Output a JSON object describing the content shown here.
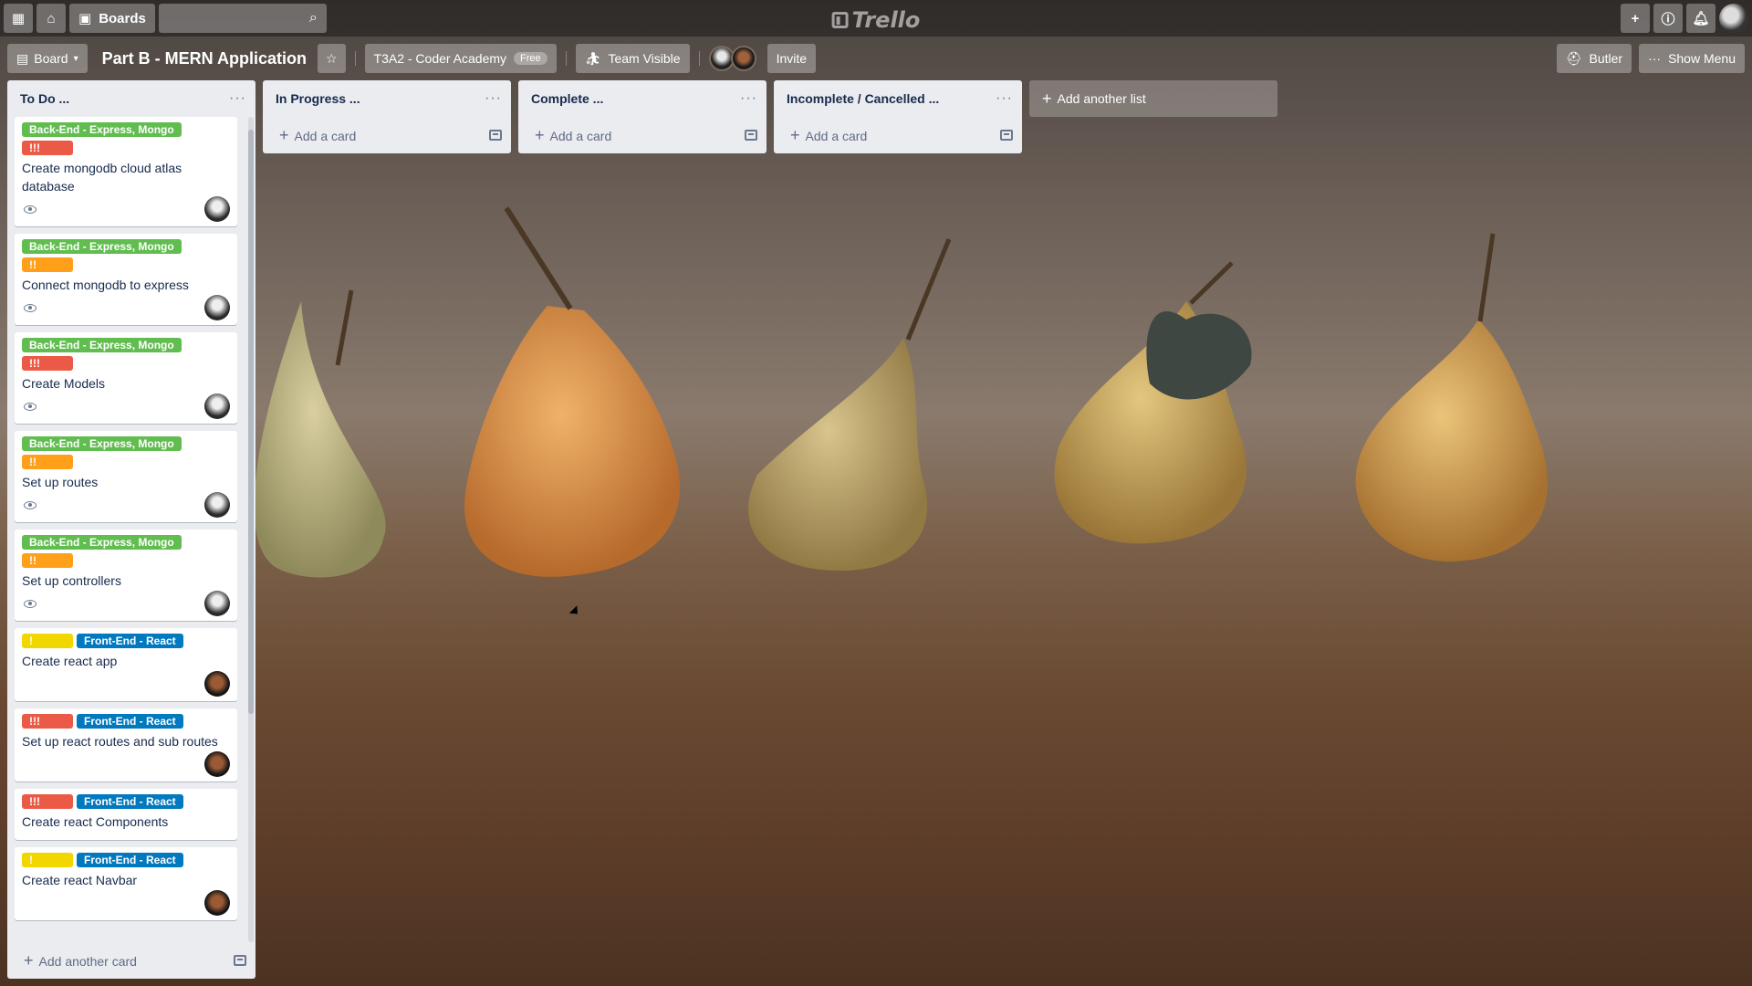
{
  "header": {
    "boards_label": "Boards",
    "logo_text": "Trello"
  },
  "board": {
    "view_label": "Board",
    "title": "Part B - MERN Application",
    "team_label": "T3A2 - Coder Academy",
    "plan_badge": "Free",
    "visibility_label": "Team Visible",
    "invite_label": "Invite",
    "butler_label": "Butler",
    "show_menu_label": "Show Menu"
  },
  "lists": [
    {
      "title": "To Do ...",
      "footer": "Add another card",
      "cards": [
        {
          "labels": [
            {
              "text": "Back-End - Express, Mongo",
              "color": "green"
            },
            {
              "text": "!!!",
              "color": "red"
            }
          ],
          "title": "Create mongodb cloud atlas database",
          "watch": true,
          "member": "a"
        },
        {
          "labels": [
            {
              "text": "Back-End - Express, Mongo",
              "color": "green"
            },
            {
              "text": "!!",
              "color": "orange"
            }
          ],
          "title": "Connect mongodb to express",
          "watch": true,
          "member": "a"
        },
        {
          "labels": [
            {
              "text": "Back-End - Express, Mongo",
              "color": "green"
            },
            {
              "text": "!!!",
              "color": "red"
            }
          ],
          "title": "Create Models",
          "watch": true,
          "member": "a"
        },
        {
          "labels": [
            {
              "text": "Back-End - Express, Mongo",
              "color": "green"
            },
            {
              "text": "!!",
              "color": "orange"
            }
          ],
          "title": "Set up routes",
          "watch": true,
          "member": "a"
        },
        {
          "labels": [
            {
              "text": "Back-End - Express, Mongo",
              "color": "green"
            },
            {
              "text": "!!",
              "color": "orange"
            }
          ],
          "title": "Set up controllers",
          "watch": true,
          "member": "a"
        },
        {
          "labels": [
            {
              "text": "!",
              "color": "yellow"
            },
            {
              "text": "Front-End - React",
              "color": "blue"
            }
          ],
          "title": "Create react app",
          "watch": false,
          "member": "b"
        },
        {
          "labels": [
            {
              "text": "!!!",
              "color": "red"
            },
            {
              "text": "Front-End - React",
              "color": "blue"
            }
          ],
          "title": "Set up react routes and sub routes",
          "watch": false,
          "member": "b"
        },
        {
          "labels": [
            {
              "text": "!!!",
              "color": "red"
            },
            {
              "text": "Front-End - React",
              "color": "blue"
            }
          ],
          "title": "Create react Components",
          "watch": false,
          "member": ""
        },
        {
          "labels": [
            {
              "text": "!",
              "color": "yellow"
            },
            {
              "text": "Front-End - React",
              "color": "blue"
            }
          ],
          "title": "Create react Navbar",
          "watch": false,
          "member": "b"
        }
      ]
    },
    {
      "title": "In Progress ...",
      "footer": "Add a card",
      "cards": []
    },
    {
      "title": "Complete ...",
      "footer": "Add a card",
      "cards": []
    },
    {
      "title": "Incomplete / Cancelled ...",
      "footer": "Add a card",
      "cards": []
    }
  ],
  "add_list_label": "Add another list",
  "colors": {
    "green": "#61bd4f",
    "red": "#eb5a46",
    "orange": "#ff9f1a",
    "yellow": "#f2d600",
    "blue": "#0079bf",
    "list_bg": "#ebecf0",
    "text": "#172b4d"
  },
  "icons": {
    "apps": "apps-grid-icon",
    "home": "home-icon",
    "boards": "boards-icon",
    "search": "search-icon",
    "add": "plus-icon",
    "info": "info-icon",
    "notifications": "bell-icon",
    "star": "star-icon",
    "visibility": "team-icon",
    "butler": "butler-icon",
    "menu": "dots-icon",
    "watch": "eye-icon",
    "template": "template-icon"
  }
}
